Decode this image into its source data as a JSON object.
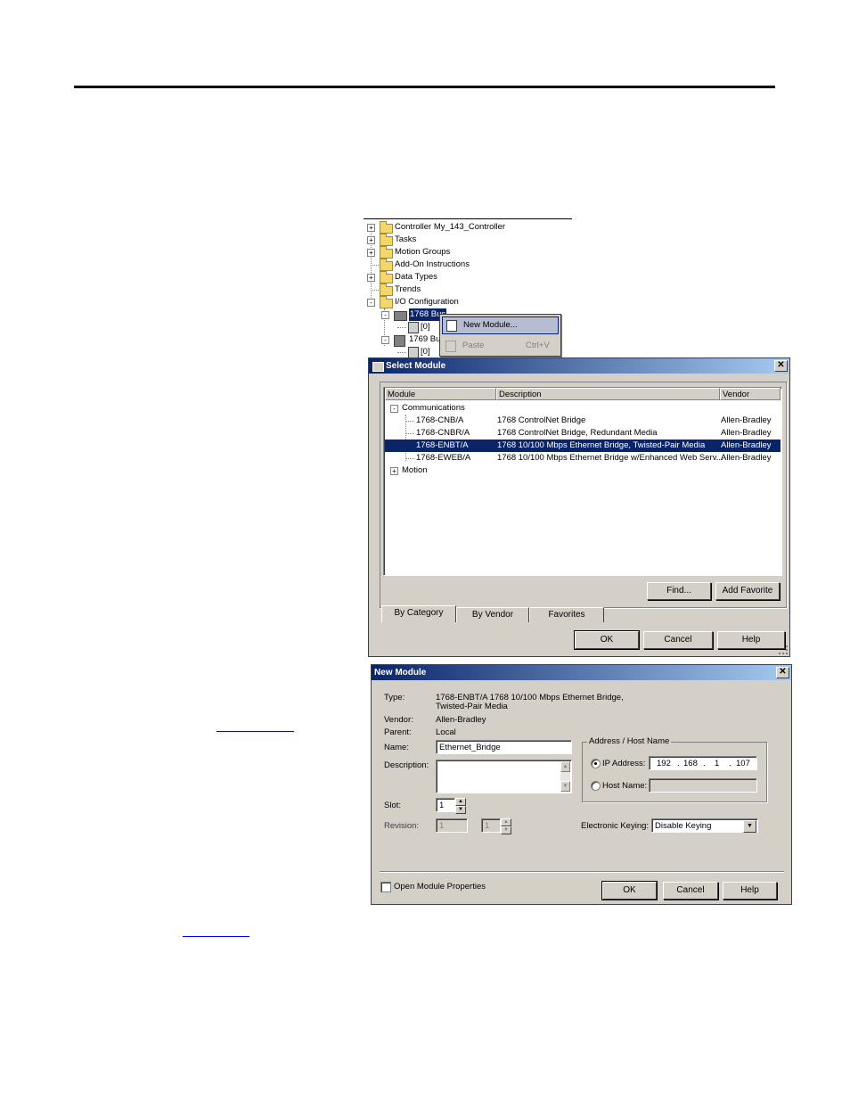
{
  "tree": {
    "items": [
      {
        "label": "Controller My_143_Controller",
        "expander": "+"
      },
      {
        "label": "Tasks",
        "expander": "+"
      },
      {
        "label": "Motion Groups",
        "expander": "+"
      },
      {
        "label": "Add-On Instructions",
        "expander": ""
      },
      {
        "label": "Data Types",
        "expander": "+"
      },
      {
        "label": "Trends",
        "expander": ""
      },
      {
        "label": "I/O Configuration",
        "expander": "-"
      }
    ],
    "bus1": {
      "label": "1768 Bus",
      "expander": "-"
    },
    "bus1_child": "[0]",
    "bus2": {
      "label": "1769 Bus",
      "expander": "-"
    },
    "bus2_child": "[0]"
  },
  "context_menu": {
    "new_module": "New Module...",
    "paste": "Paste",
    "paste_shortcut": "Ctrl+V"
  },
  "select_module": {
    "title": "Select Module",
    "columns": {
      "module": "Module",
      "description": "Description",
      "vendor": "Vendor"
    },
    "group_communications": "Communications",
    "group_motion": "Motion",
    "rows": [
      {
        "module": "1768-CNB/A",
        "description": "1768 ControlNet Bridge",
        "vendor": "Allen-Bradley",
        "selected": false
      },
      {
        "module": "1768-CNBR/A",
        "description": "1768 ControlNet Bridge, Redundant Media",
        "vendor": "Allen-Bradley",
        "selected": false
      },
      {
        "module": "1768-ENBT/A",
        "description": "1768 10/100 Mbps Ethernet Bridge, Twisted-Pair Media",
        "vendor": "Allen-Bradley",
        "selected": true
      },
      {
        "module": "1768-EWEB/A",
        "description": "1768 10/100 Mbps Ethernet Bridge w/Enhanced Web Serv...",
        "vendor": "Allen-Bradley",
        "selected": false
      }
    ],
    "find_button": "Find...",
    "add_favorite_button": "Add Favorite",
    "tabs": [
      "By Category",
      "By Vendor",
      "Favorites"
    ],
    "ok": "OK",
    "cancel": "Cancel",
    "help": "Help"
  },
  "new_module": {
    "title": "New Module",
    "type_label": "Type:",
    "type_value_line1": "1768-ENBT/A 1768 10/100 Mbps Ethernet Bridge,",
    "type_value_line2": "Twisted-Pair Media",
    "vendor_label": "Vendor:",
    "vendor_value": "Allen-Bradley",
    "parent_label": "Parent:",
    "parent_value": "Local",
    "name_label": "Name:",
    "name_value": "Ethernet_Bridge",
    "description_label": "Description:",
    "slot_label": "Slot:",
    "slot_value": "1",
    "revision_label": "Revision:",
    "revision_major": "1",
    "revision_minor": "1",
    "address_group": "Address / Host Name",
    "ip_label": "IP Address:",
    "ip": [
      "192",
      "168",
      "1",
      "107"
    ],
    "host_label": "Host Name:",
    "keying_label": "Electronic Keying:",
    "keying_value": "Disable Keying",
    "open_props": "Open Module Properties",
    "ok": "OK",
    "cancel": "Cancel",
    "help": "Help"
  }
}
